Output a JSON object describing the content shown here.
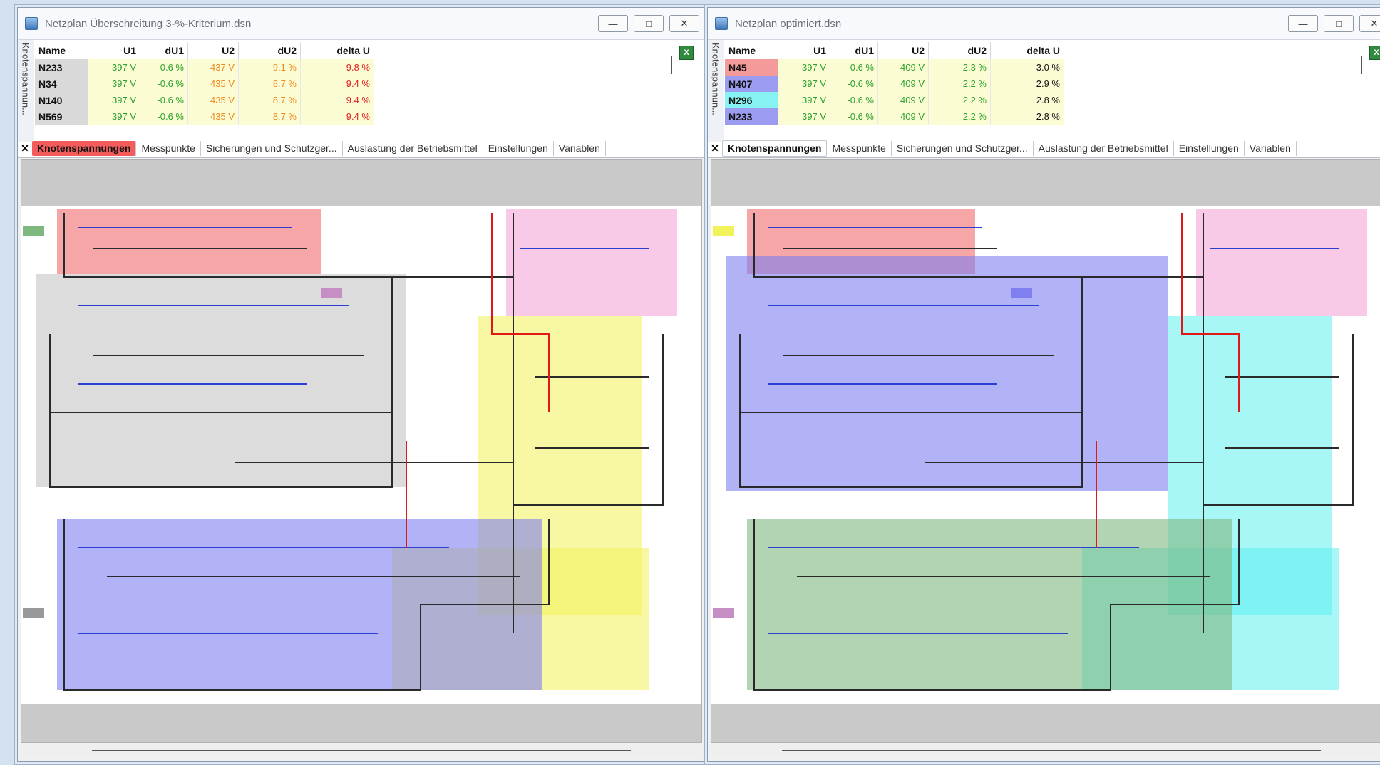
{
  "windows": {
    "left": {
      "title": "Netzplan Überschreitung 3-%-Kriterium.dsn",
      "vtab": "Knotenspannun...",
      "columns": [
        "Name",
        "U1",
        "dU1",
        "U2",
        "dU2",
        "delta U"
      ],
      "rows": [
        {
          "name": "N233",
          "u1": "397 V",
          "du1": "-0.6 %",
          "u2": "437 V",
          "du2": "9.1 %",
          "delta": "9.8 %"
        },
        {
          "name": "N34",
          "u1": "397 V",
          "du1": "-0.6 %",
          "u2": "435 V",
          "du2": "8.7 %",
          "delta": "9.4 %"
        },
        {
          "name": "N140",
          "u1": "397 V",
          "du1": "-0.6 %",
          "u2": "435 V",
          "du2": "8.7 %",
          "delta": "9.4 %"
        },
        {
          "name": "N569",
          "u1": "397 V",
          "du1": "-0.6 %",
          "u2": "435 V",
          "du2": "8.7 %",
          "delta": "9.4 %"
        }
      ],
      "tabs": [
        "Knotenspannungen",
        "Messpunkte",
        "Sicherungen und Schutzger...",
        "Auslastung der Betriebsmittel",
        "Einstellungen",
        "Variablen"
      ],
      "colors": {
        "u1": "#2ca32c",
        "du1": "#2ca32c",
        "u2": "#f08a1f",
        "du2": "#f08a1f",
        "delta": "#e11b1b",
        "active_tab": "#f45c5c"
      }
    },
    "right": {
      "title": "Netzplan optimiert.dsn",
      "vtab": "Knotenspannun...",
      "columns": [
        "Name",
        "U1",
        "dU1",
        "U2",
        "dU2",
        "delta U"
      ],
      "rows": [
        {
          "name": "N45",
          "u1": "397 V",
          "du1": "-0.6 %",
          "u2": "409 V",
          "du2": "2.3 %",
          "delta": "3.0 %",
          "name_bg": "#f59a9a"
        },
        {
          "name": "N407",
          "u1": "397 V",
          "du1": "-0.6 %",
          "u2": "409 V",
          "du2": "2.2 %",
          "delta": "2.9 %",
          "name_bg": "#9b9bf0"
        },
        {
          "name": "N296",
          "u1": "397 V",
          "du1": "-0.6 %",
          "u2": "409 V",
          "du2": "2.2 %",
          "delta": "2.8 %",
          "name_bg": "#86f2f2"
        },
        {
          "name": "N233",
          "u1": "397 V",
          "du1": "-0.6 %",
          "u2": "409 V",
          "du2": "2.2 %",
          "delta": "2.8 %",
          "name_bg": "#9b9bf0"
        }
      ],
      "tabs": [
        "Knotenspannungen",
        "Messpunkte",
        "Sicherungen und Schutzger...",
        "Auslastung der Betriebsmittel",
        "Einstellungen",
        "Variablen"
      ]
    }
  },
  "network_colors": {
    "left": [
      "#f06a6a",
      "#f4a6d8",
      "#c5c5c5",
      "#f2f25a",
      "#7f7ff0"
    ],
    "right": [
      "#f06a6a",
      "#f4a6d8",
      "#7f7ff0",
      "#5ef0f0",
      "#7fb87f"
    ]
  }
}
